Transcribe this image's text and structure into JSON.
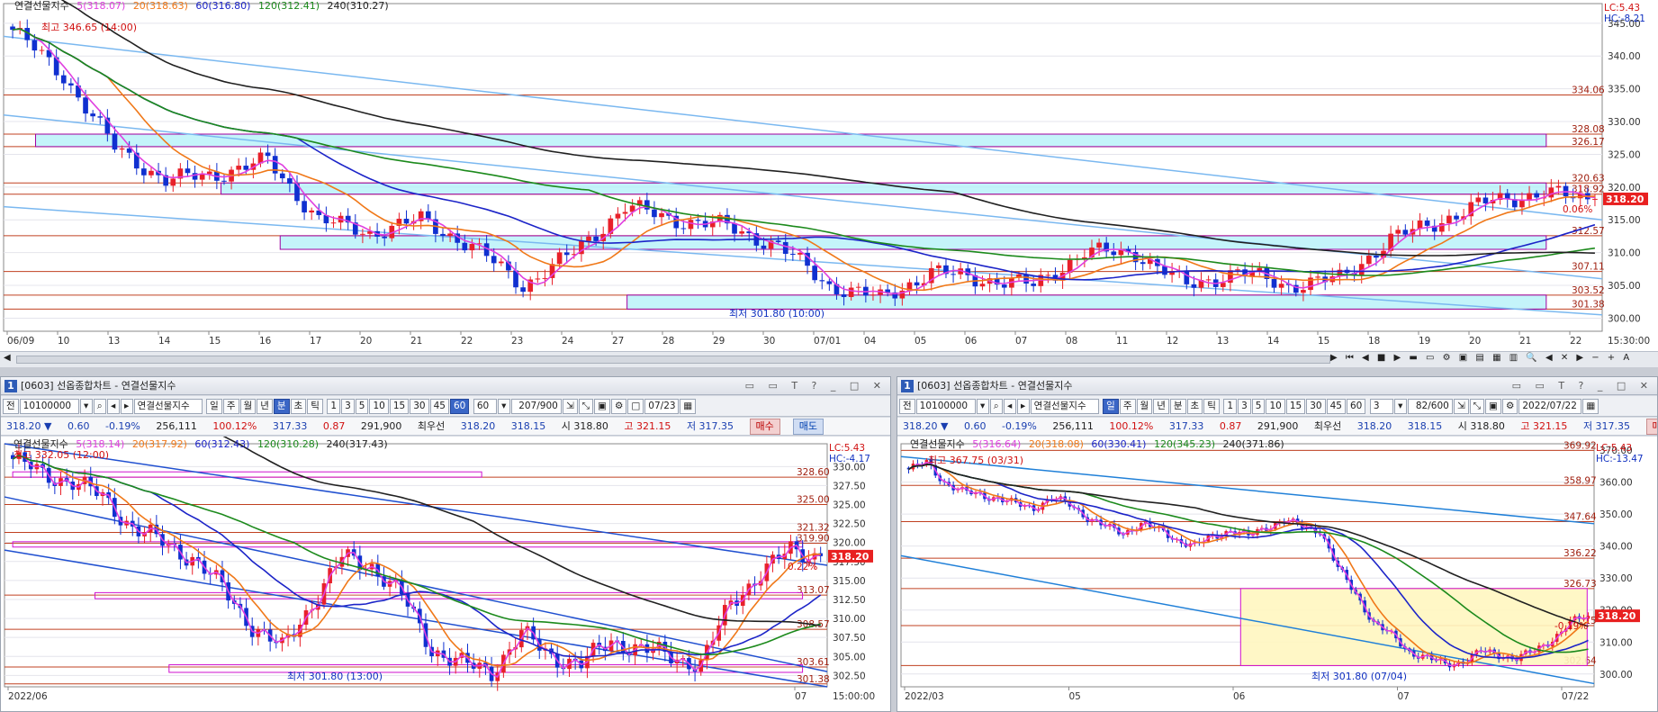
{
  "colors": {
    "up": "#e8202a",
    "down": "#1030d0",
    "ma5": "#e040e0",
    "ma20": "#f07818",
    "ma60": "#1c24c8",
    "ma120": "#1c8a1c",
    "ma240": "#202020",
    "channel": "#7ab8f0",
    "hline": "#c04020",
    "box": "#b0f0f8",
    "boxborder": "#a000a0",
    "price": "#e82020"
  },
  "top": {
    "legend": {
      "name": "연결선물지수",
      "ma5": "5(318.07)",
      "ma20": "20(318.63)",
      "ma60": "60(316.80)",
      "ma120": "120(312.41)",
      "ma240": "240(310.27)"
    },
    "lc": "LC:5.43",
    "hc": "HC:-8.21",
    "high_label": "최고 346.65 (14:00)",
    "low_label": "최저 301.80 (10:00)",
    "price_badge": "318.20",
    "pct_badge": "0.06%",
    "yticks": [
      "345.00",
      "340.00",
      "335.00",
      "330.00",
      "325.00",
      "320.00",
      "315.00",
      "310.00",
      "305.00",
      "300.00"
    ],
    "levels": [
      "334.06",
      "328.08",
      "326.17",
      "320.63",
      "318.92",
      "312.57",
      "307.11",
      "303.52",
      "301.38"
    ],
    "xlabels": [
      "06/09",
      "10",
      "13",
      "14",
      "15",
      "16",
      "17",
      "20",
      "21",
      "22",
      "23",
      "24",
      "27",
      "28",
      "29",
      "30",
      "07/01",
      "04",
      "05",
      "06",
      "07",
      "08",
      "11",
      "12",
      "13",
      "14",
      "15",
      "18",
      "19",
      "20",
      "21",
      "22"
    ],
    "time": "15:30:00"
  },
  "left": {
    "title": "[0603] 선옵종합차트 - 연결선물지수",
    "toolbar": {
      "jeon": "전",
      "code": "10100000",
      "name": "연결선물지수",
      "periods": [
        "일",
        "주",
        "월",
        "년",
        "분",
        "초",
        "틱"
      ],
      "mins": [
        "1",
        "3",
        "5",
        "10",
        "15",
        "30",
        "45",
        "60"
      ],
      "sel_min": "60",
      "count": "60",
      "ratio": "207/900",
      "date": "07/23"
    },
    "quote": {
      "price": "318.20",
      "arrow": "▼",
      "chg": "0.60",
      "pct": "-0.19%",
      "vol": "256,111",
      "rate": "100.12%",
      "p2": "317.33",
      "c2": "0.87",
      "oi": "291,900",
      "best_label": "최우선",
      "bid": "318.20",
      "ask": "318.15",
      "open": "시 318.80",
      "high": "고 321.15",
      "low": "저 317.35",
      "buy": "매수",
      "sell": "매도"
    },
    "legend": {
      "name": "연결선물지수",
      "ma5": "5(318.14)",
      "ma20": "20(317.92)",
      "ma60": "60(312.43)",
      "ma120": "120(310.28)",
      "ma240": "240(317.43)"
    },
    "lc": "LC:5.43",
    "hc": "HC:-4.17",
    "high_label": "최고 332.05 (12:00)",
    "low_label": "최저 301.80 (13:00)",
    "price_badge": "318.20",
    "pct_badge": "0.22%",
    "yticks": [
      "330.00",
      "327.50",
      "325.00",
      "322.50",
      "320.00",
      "317.50",
      "315.00",
      "312.50",
      "310.00",
      "307.50",
      "305.00",
      "302.50"
    ],
    "levels": [
      "328.60",
      "325.00",
      "321.32",
      "319.90",
      "313.07",
      "308.57",
      "303.61",
      "301.38"
    ],
    "xlabels": [
      "2022/06",
      "07"
    ],
    "time": "15:00:00"
  },
  "right": {
    "title": "[0603] 선옵종합차트 - 연결선물지수",
    "toolbar": {
      "jeon": "전",
      "code": "10100000",
      "name": "연결선물지수",
      "periods": [
        "일",
        "주",
        "월",
        "년",
        "분",
        "초",
        "틱"
      ],
      "sel_period": "일",
      "mins": [
        "1",
        "3",
        "5",
        "10",
        "15",
        "30",
        "45",
        "60"
      ],
      "count": "3",
      "ratio": "82/600",
      "date": "2022/07/22"
    },
    "quote": {
      "price": "318.20",
      "arrow": "▼",
      "chg": "0.60",
      "pct": "-0.19%",
      "vol": "256,111",
      "rate": "100.12%",
      "p2": "317.33",
      "c2": "0.87",
      "oi": "291,900",
      "best_label": "최우선",
      "bid": "318.20",
      "ask": "318.15",
      "open": "시 318.80",
      "high": "고 321.15",
      "low": "저 317.35",
      "buy": "매수",
      "sell": "매도"
    },
    "legend": {
      "name": "연결선물지수",
      "ma5": "5(316.64)",
      "ma20": "20(318.08)",
      "ma60": "60(330.41)",
      "ma120": "120(345.23)",
      "ma240": "240(371.86)"
    },
    "lc": "LC:5.43",
    "hc": "HC:-13.47",
    "high_label": "최고 367.75 (03/31)",
    "low_label": "최저 301.80 (07/04)",
    "price_badge": "318.20",
    "pct_badge": "-0.19%",
    "yticks": [
      "370.00",
      "360.00",
      "350.00",
      "340.00",
      "330.00",
      "320.00",
      "310.00",
      "300.00"
    ],
    "levels": [
      "369.92",
      "358.97",
      "347.64",
      "336.22",
      "326.73",
      "315.15",
      "302.64"
    ],
    "xlabels": [
      "2022/03",
      "05",
      "06",
      "07",
      "07/22"
    ]
  },
  "chart_data": [
    {
      "type": "candlestick",
      "title": "연결선물지수 30분",
      "ylim": [
        298,
        348
      ],
      "x": [
        "06/09",
        "10",
        "13",
        "14",
        "15",
        "16",
        "17",
        "20",
        "21",
        "22",
        "23",
        "24",
        "27",
        "28",
        "29",
        "30",
        "07/01",
        "04",
        "05",
        "06",
        "07",
        "08",
        "11",
        "12",
        "13",
        "14",
        "15",
        "18",
        "19",
        "20",
        "21",
        "22"
      ],
      "close": [
        344,
        337,
        326,
        321,
        322,
        324,
        315,
        313,
        315,
        311,
        305,
        310,
        317,
        315,
        314,
        311,
        305,
        303,
        307,
        306,
        305,
        310,
        310,
        305,
        307,
        305,
        306,
        312,
        315,
        318,
        319,
        318.2
      ],
      "series": [
        {
          "name": "5",
          "last": 318.07
        },
        {
          "name": "20",
          "last": 318.63
        },
        {
          "name": "60",
          "last": 316.8
        },
        {
          "name": "120",
          "last": 312.41
        },
        {
          "name": "240",
          "last": 310.27
        }
      ]
    },
    {
      "type": "candlestick",
      "title": "연결선물지수 60분",
      "ylim": [
        301,
        333
      ],
      "x": [
        "2022/06",
        "07"
      ],
      "close": [
        331,
        329,
        328,
        326,
        322,
        320,
        318,
        314,
        309,
        306,
        312,
        318,
        317,
        313,
        306,
        304,
        303,
        308,
        305,
        304,
        307,
        306,
        305,
        304,
        312,
        316,
        319,
        318.2
      ],
      "series": [
        {
          "name": "5",
          "last": 318.14
        },
        {
          "name": "20",
          "last": 317.92
        },
        {
          "name": "60",
          "last": 312.43
        },
        {
          "name": "120",
          "last": 310.28
        },
        {
          "name": "240",
          "last": 317.43
        }
      ]
    },
    {
      "type": "candlestick",
      "title": "연결선물지수 일",
      "ylim": [
        296,
        372
      ],
      "x": [
        "2022/03",
        "05",
        "06",
        "07",
        "07/22"
      ],
      "close": [
        364,
        366,
        360,
        357,
        356,
        355,
        353,
        352,
        355,
        353,
        349,
        346,
        344,
        347,
        345,
        342,
        340,
        343,
        345,
        343,
        346,
        348,
        346,
        345,
        333,
        325,
        316,
        312,
        307,
        305,
        303,
        304,
        307,
        306,
        305,
        307,
        311,
        316,
        318.2
      ],
      "series": [
        {
          "name": "5",
          "last": 316.64
        },
        {
          "name": "20",
          "last": 318.08
        },
        {
          "name": "60",
          "last": 330.41
        },
        {
          "name": "120",
          "last": 345.23
        },
        {
          "name": "240",
          "last": 371.86
        }
      ]
    }
  ]
}
